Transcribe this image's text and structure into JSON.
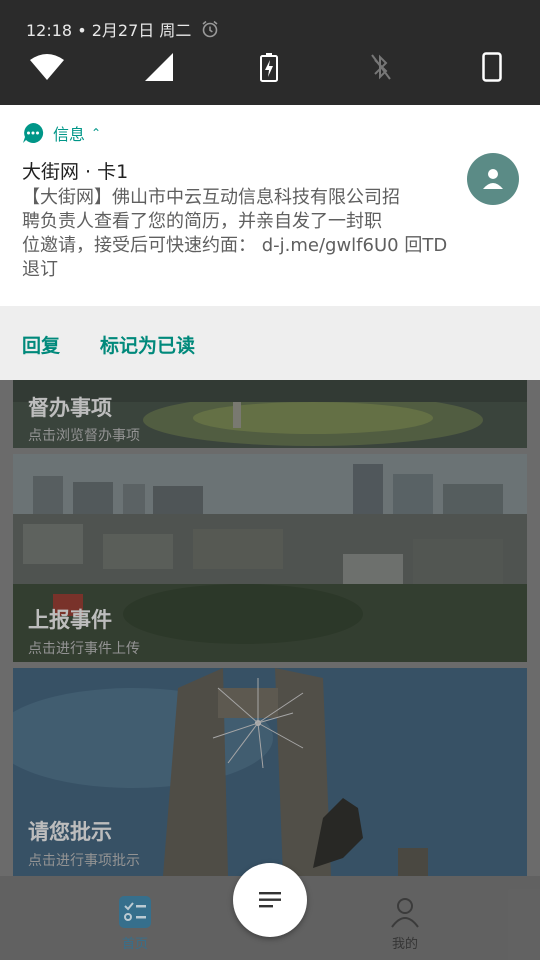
{
  "status": {
    "time_date": "12:18 • 2月27日 周二"
  },
  "quick_settings": [
    "wifi-icon",
    "signal-icon",
    "battery-charging-icon",
    "bluetooth-off-icon",
    "phone-icon"
  ],
  "notification": {
    "app_name": "信息",
    "title": "大街网 · 卡1",
    "body_lines": [
      "【大街网】佛山市中云互动信息科技有限公司招",
      "聘负责人查看了您的简历，并亲自发了一封职",
      "位邀请，接受后可快速约面： d-j.me/gwlf6U0 回TD",
      "退订"
    ],
    "actions": {
      "reply": "回复",
      "mark_read": "标记为已读"
    },
    "accent_color": "#009688"
  },
  "app": {
    "cards": [
      {
        "title": "督办事项",
        "subtitle": "点击浏览督办事项"
      },
      {
        "title": "上报事件",
        "subtitle": "点击进行事件上传"
      },
      {
        "title": "请您批示",
        "subtitle": "点击进行事项批示"
      }
    ],
    "tabs": {
      "home": "首页",
      "mine": "我的"
    }
  }
}
